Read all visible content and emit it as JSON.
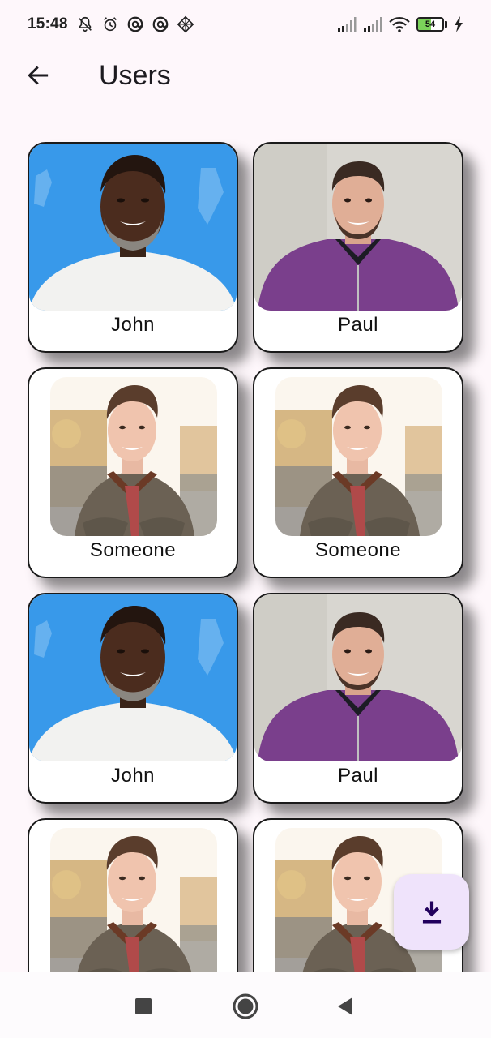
{
  "status_bar": {
    "time": "15:48",
    "battery_level": "54",
    "battery_fraction": 0.54,
    "left_icons": [
      "notifications-off-icon",
      "alarm-icon",
      "at-sign-icon",
      "at-sign-icon",
      "diamond-grid-icon"
    ],
    "right_icons": [
      "signal-icon",
      "signal-icon",
      "wifi-icon",
      "battery-icon",
      "charging-bolt-icon"
    ]
  },
  "app_bar": {
    "back_icon": "arrow-left-icon",
    "title": "Users"
  },
  "users": [
    {
      "name": "John",
      "photo": "john"
    },
    {
      "name": "Paul",
      "photo": "paul"
    },
    {
      "name": "Someone",
      "photo": "someone"
    },
    {
      "name": "Someone",
      "photo": "someone"
    },
    {
      "name": "John",
      "photo": "john"
    },
    {
      "name": "Paul",
      "photo": "paul"
    },
    {
      "name": "",
      "photo": "someone"
    },
    {
      "name": "",
      "photo": "someone"
    }
  ],
  "fab": {
    "icon": "download-icon"
  },
  "nav_bar": {
    "icons": [
      "recents-square-icon",
      "home-circle-icon",
      "back-triangle-icon"
    ]
  },
  "colors": {
    "background": "#fef7fb",
    "fab": "#efe3fb",
    "fab_icon": "#21005d",
    "text": "#1d1b20"
  }
}
